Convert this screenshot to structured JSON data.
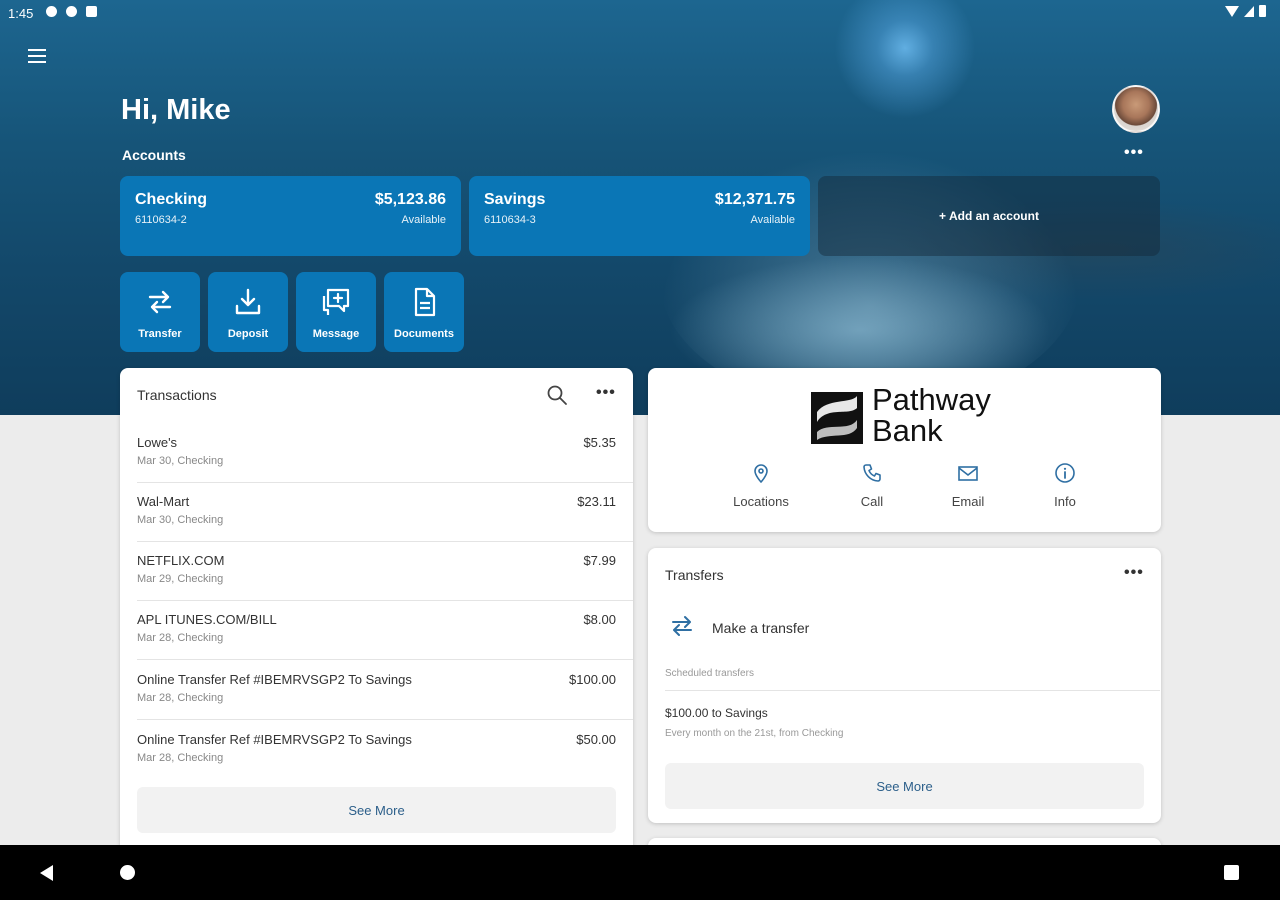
{
  "status": {
    "time": "1:45"
  },
  "greeting": "Hi, Mike",
  "accounts": {
    "label": "Accounts",
    "items": [
      {
        "name": "Checking",
        "number": "6110634-2",
        "balance": "$5,123.86",
        "available_label": "Available"
      },
      {
        "name": "Savings",
        "number": "6110634-3",
        "balance": "$12,371.75",
        "available_label": "Available"
      }
    ],
    "add_label": "+ Add an account"
  },
  "actions": [
    {
      "label": "Transfer",
      "icon": "swap-arrows-icon"
    },
    {
      "label": "Deposit",
      "icon": "download-tray-icon"
    },
    {
      "label": "Message",
      "icon": "chat-plus-icon"
    },
    {
      "label": "Documents",
      "icon": "document-icon"
    }
  ],
  "transactions": {
    "title": "Transactions",
    "items": [
      {
        "description": "Lowe's",
        "meta": "Mar 30, Checking",
        "amount": "$5.35"
      },
      {
        "description": "Wal-Mart",
        "meta": "Mar 30, Checking",
        "amount": "$23.11"
      },
      {
        "description": "NETFLIX.COM",
        "meta": "Mar 29, Checking",
        "amount": "$7.99"
      },
      {
        "description": "APL ITUNES.COM/BILL",
        "meta": "Mar 28, Checking",
        "amount": "$8.00"
      },
      {
        "description": "Online Transfer Ref #IBEMRVSGP2 To Savings",
        "meta": "Mar 28, Checking",
        "amount": "$100.00"
      },
      {
        "description": "Online Transfer Ref #IBEMRVSGP2 To Savings",
        "meta": "Mar 28, Checking",
        "amount": "$50.00"
      }
    ],
    "see_more": "See More"
  },
  "bank": {
    "name_line1": "Pathway",
    "name_line2": "Bank",
    "quick_links": [
      {
        "label": "Locations",
        "icon": "location-pin-icon"
      },
      {
        "label": "Call",
        "icon": "phone-icon"
      },
      {
        "label": "Email",
        "icon": "envelope-icon"
      },
      {
        "label": "Info",
        "icon": "info-icon"
      }
    ]
  },
  "transfers": {
    "title": "Transfers",
    "make_label": "Make a transfer",
    "scheduled_label": "Scheduled transfers",
    "scheduled": [
      {
        "title": "$100.00 to Savings",
        "subtitle": "Every month on the 21st, from Checking"
      }
    ],
    "see_more": "See More"
  },
  "colors": {
    "accent": "#0a76b6",
    "link": "#2c5f8a"
  }
}
